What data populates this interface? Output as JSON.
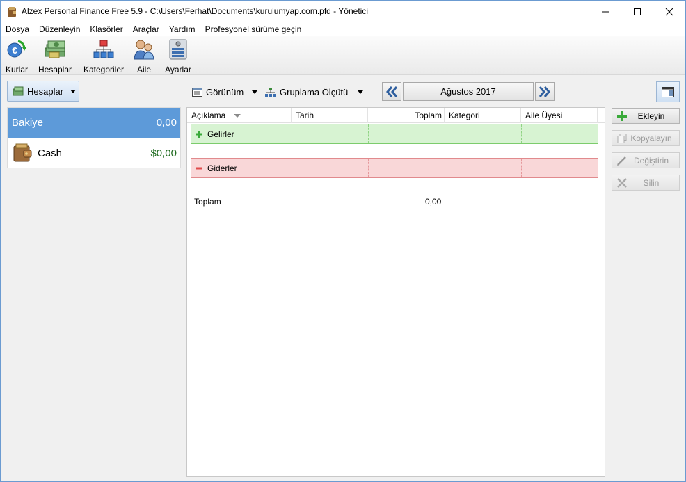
{
  "window": {
    "title": "Alzex Personal Finance Free 5.9 - C:\\Users\\Ferhat\\Documents\\kurulumyap.com.pfd - Yönetici"
  },
  "menu": [
    "Dosya",
    "Düzenleyin",
    "Klasörler",
    "Araçlar",
    "Yardım",
    "Profesyonel sürüme geçin"
  ],
  "toolbar": {
    "kurlar": "Kurlar",
    "hesaplar": "Hesaplar",
    "kategoriler": "Kategoriler",
    "aile": "Aile",
    "ayarlar": "Ayarlar"
  },
  "left": {
    "accounts_button": "Hesaplar",
    "accounts": [
      {
        "name": "Bakiye",
        "value": "0,00"
      },
      {
        "name": "Cash",
        "value": "$0,00"
      }
    ]
  },
  "view": {
    "gorunum": "Görünüm",
    "gruplama": "Gruplama Ölçütü",
    "month": "Ağustos 2017"
  },
  "grid": {
    "columns": [
      "Açıklama",
      "Tarih",
      "Toplam",
      "Kategori",
      "Aile Üyesi"
    ],
    "groups": {
      "income": "Gelirler",
      "expense": "Giderler"
    },
    "total_label": "Toplam",
    "total_value": "0,00"
  },
  "actions": {
    "add": "Ekleyin",
    "copy": "Kopyalayın",
    "edit": "Değiştirin",
    "delete": "Silin"
  },
  "colors": {
    "selected_account": "#5d9ad9",
    "income_bg": "#d7f3d2",
    "expense_bg": "#f9d7d8",
    "cash_value": "#1f6b1f"
  }
}
